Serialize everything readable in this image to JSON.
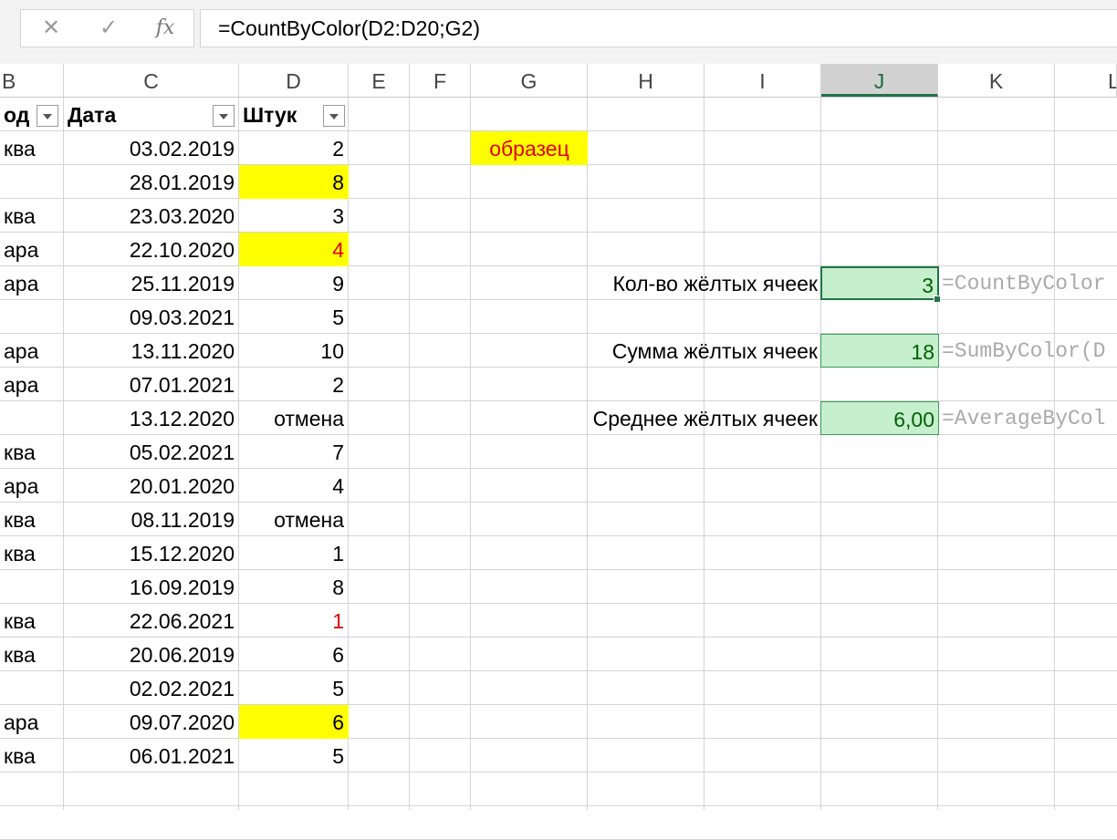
{
  "formula_bar": {
    "cancel_icon": "close-icon",
    "cancel_glyph": "✕",
    "enter_icon": "check-icon",
    "enter_glyph": "✓",
    "fx_label": "fx",
    "formula": "=CountByColor(D2:D20;G2)"
  },
  "columns": [
    "B",
    "C",
    "D",
    "E",
    "F",
    "G",
    "H",
    "I",
    "J",
    "K",
    "L"
  ],
  "selected_column": "J",
  "table": {
    "headers": {
      "b": "од",
      "c": "Дата",
      "d": "Штук"
    },
    "rows": [
      {
        "b": "ква",
        "c": "03.02.2019",
        "d": "2"
      },
      {
        "b": "",
        "c": "28.01.2019",
        "d": "8"
      },
      {
        "b": "ква",
        "c": "23.03.2020",
        "d": "3"
      },
      {
        "b": "ара",
        "c": "22.10.2020",
        "d": "4"
      },
      {
        "b": "ара",
        "c": "25.11.2019",
        "d": "9"
      },
      {
        "b": "",
        "c": "09.03.2021",
        "d": "5"
      },
      {
        "b": "ара",
        "c": "13.11.2020",
        "d": "10"
      },
      {
        "b": "ара",
        "c": "07.01.2021",
        "d": "2"
      },
      {
        "b": "",
        "c": "13.12.2020",
        "d": "отмена"
      },
      {
        "b": "ква",
        "c": "05.02.2021",
        "d": "7"
      },
      {
        "b": "ара",
        "c": "20.01.2020",
        "d": "4"
      },
      {
        "b": "ква",
        "c": "08.11.2019",
        "d": "отмена"
      },
      {
        "b": "ква",
        "c": "15.12.2020",
        "d": "1"
      },
      {
        "b": "",
        "c": "16.09.2019",
        "d": "8"
      },
      {
        "b": "ква",
        "c": "22.06.2021",
        "d": "1"
      },
      {
        "b": "ква",
        "c": "20.06.2019",
        "d": "6"
      },
      {
        "b": "",
        "c": "02.02.2021",
        "d": "5"
      },
      {
        "b": "ара",
        "c": "09.07.2020",
        "d": "6"
      },
      {
        "b": "ква",
        "c": "06.01.2021",
        "d": "5"
      }
    ]
  },
  "sample_cell": {
    "text": "образец",
    "background": "#ffff00",
    "color": "#e00000"
  },
  "summary": [
    {
      "label": "Кол-во жёлтых ячеек",
      "value": "3",
      "formula": "=CountByColor"
    },
    {
      "label": "Сумма жёлтых ячеек",
      "value": "18",
      "formula": "=SumByColor(D"
    },
    {
      "label": "Среднее жёлтых ячеек",
      "value": "6,00",
      "formula": "=AverageByCol"
    }
  ],
  "colors": {
    "highlight_yellow": "#ffff00",
    "red_text": "#e00000",
    "result_fill": "#c6efce",
    "result_text": "#006100",
    "selection": "#217346"
  }
}
